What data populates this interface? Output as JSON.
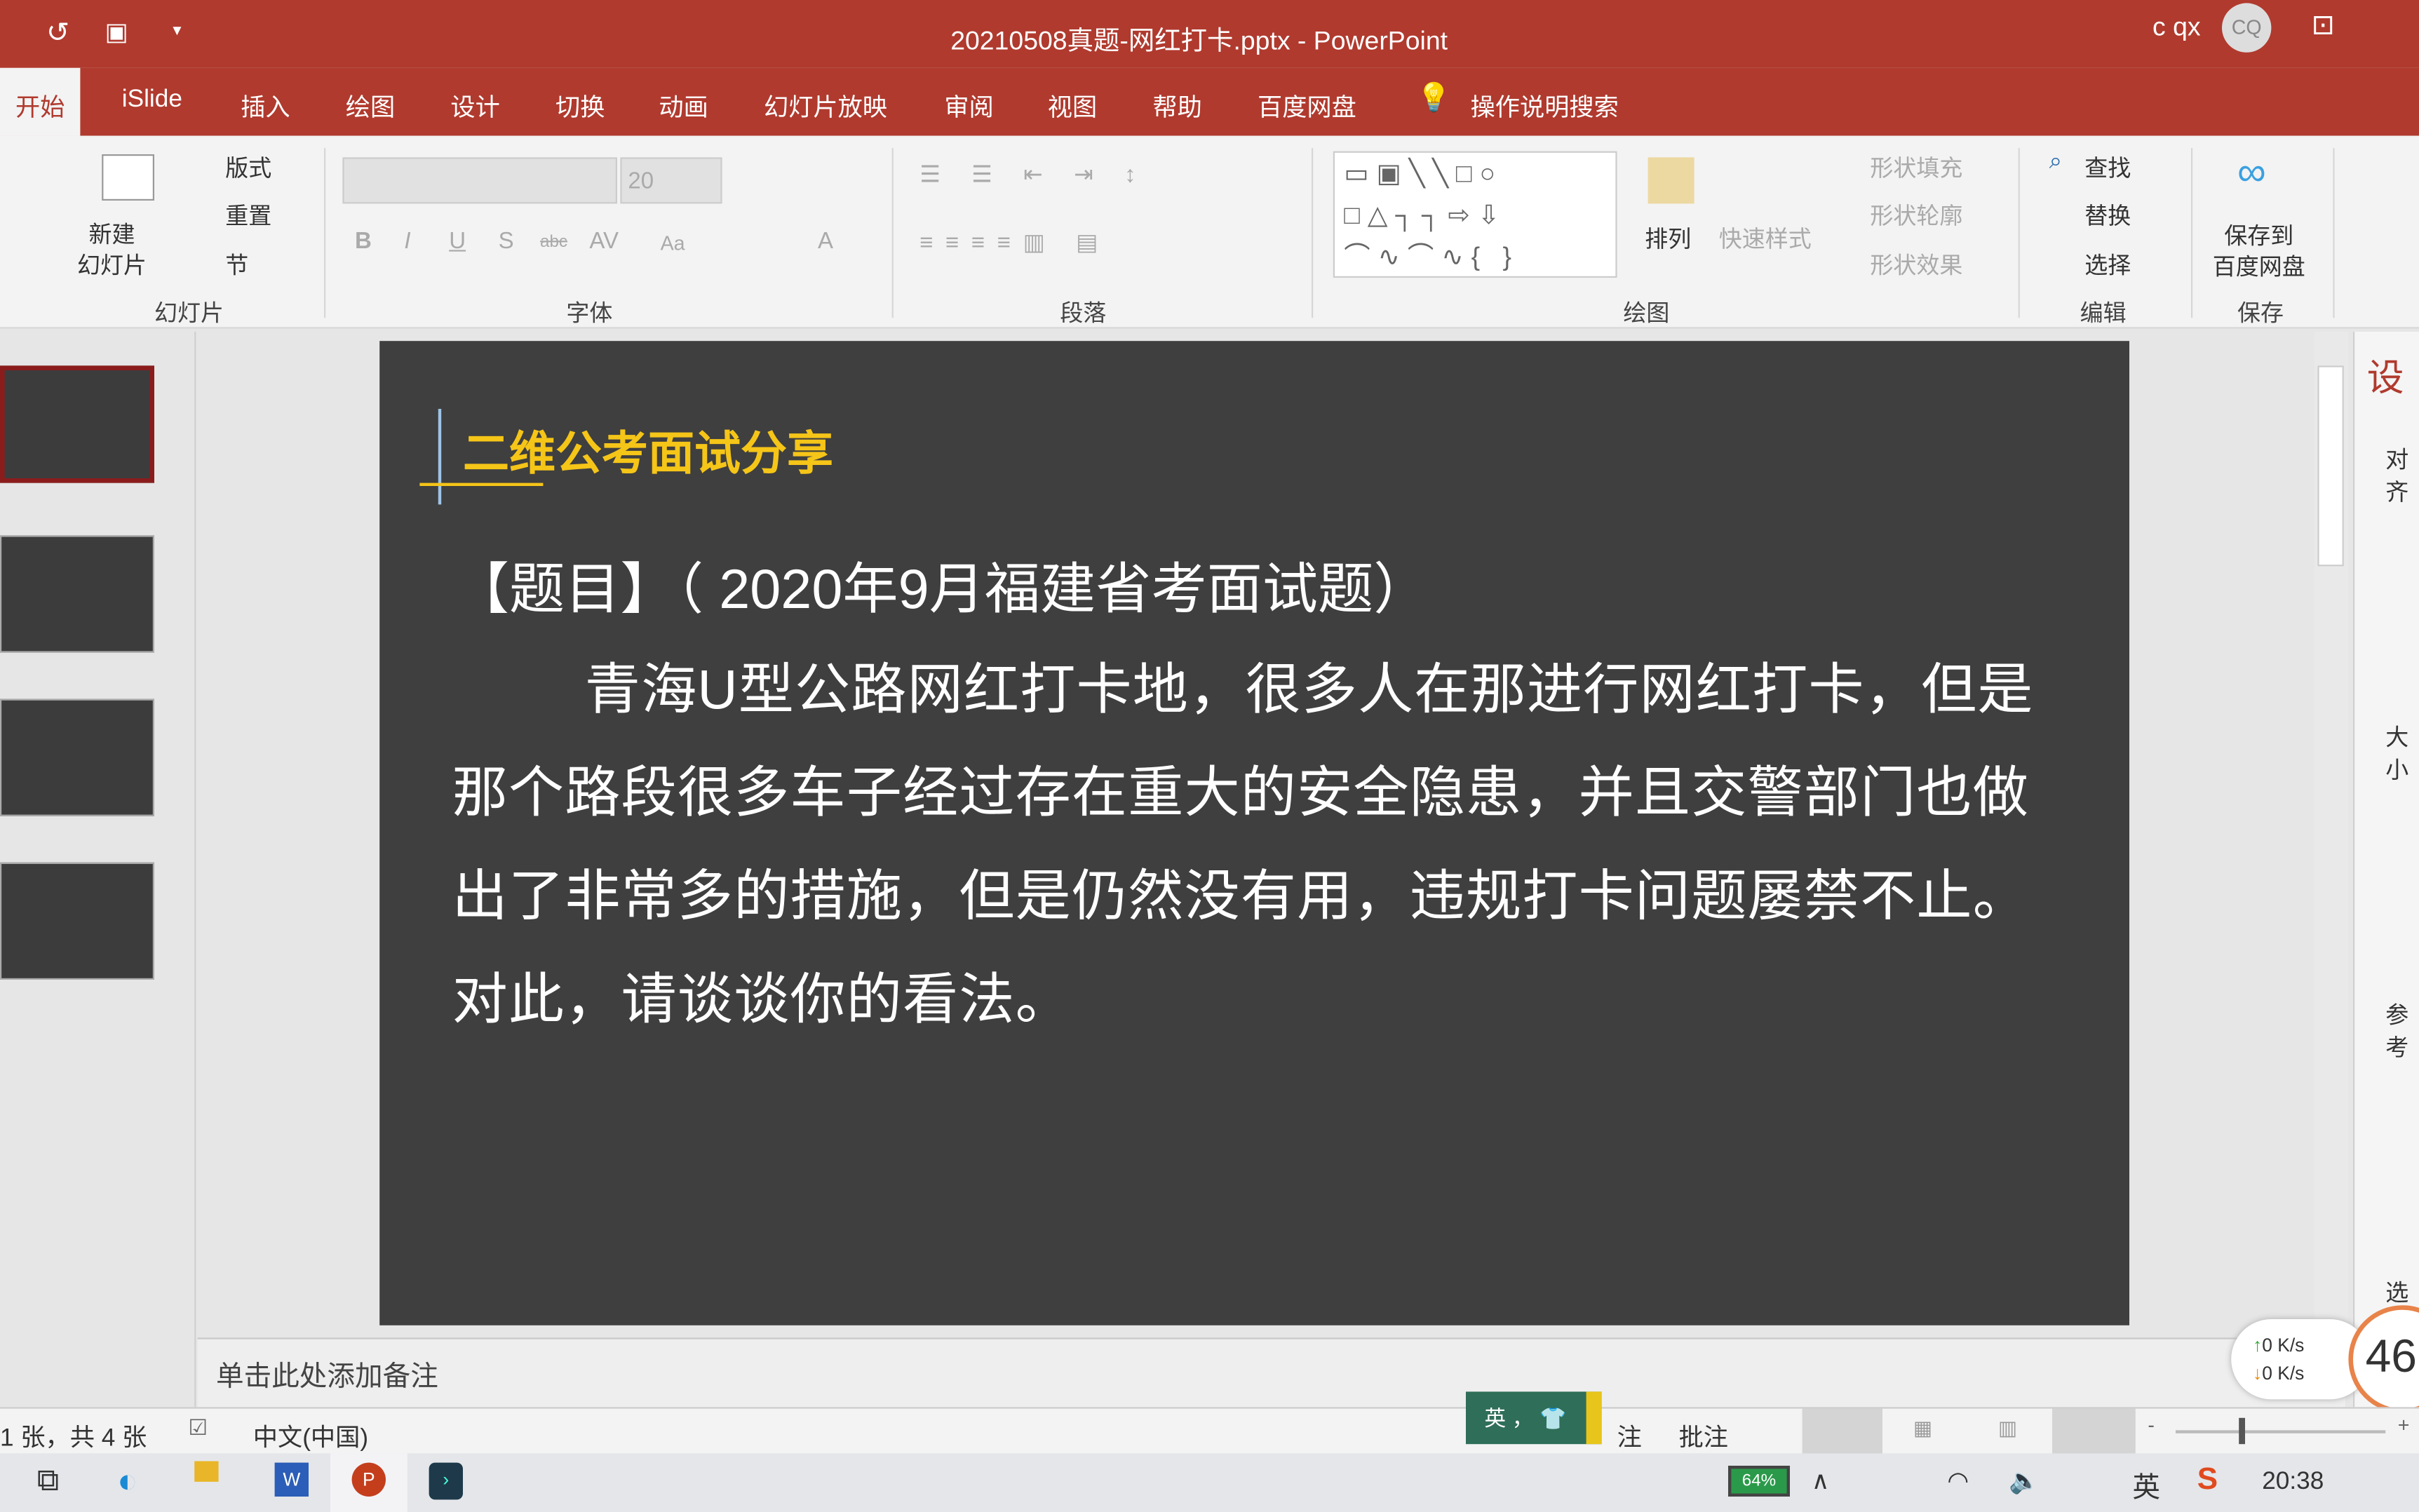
{
  "titlebar": {
    "title": "20210508真题-网红打卡.pptx  -  PowerPoint",
    "user": "c qx",
    "avatar": "CQ"
  },
  "tabs": [
    "开始",
    "iSlide",
    "插入",
    "绘图",
    "设计",
    "切换",
    "动画",
    "幻灯片放映",
    "审阅",
    "视图",
    "帮助",
    "百度网盘"
  ],
  "tell_me": "操作说明搜索",
  "ribbon": {
    "slides": {
      "new_slide": "新建\n幻灯片",
      "layout": "版式",
      "reset": "重置",
      "section": "节",
      "label": "幻灯片"
    },
    "font": {
      "font_size": "20",
      "label": "字体",
      "bold": "B",
      "italic": "I",
      "underline": "U",
      "shadow": "S",
      "strike": "abc",
      "spacing": "AV",
      "case": "Aa",
      "color": "A"
    },
    "paragraph": {
      "label": "段落"
    },
    "drawing": {
      "arrange": "排列",
      "quick_styles": "快速样式",
      "shape_fill": "形状填充",
      "shape_outline": "形状轮廓",
      "shape_effects": "形状效果",
      "label": "绘图"
    },
    "editing": {
      "find": "查找",
      "replace": "替换",
      "select": "选择",
      "label": "编辑"
    },
    "save": {
      "save_baidu": "保存到\n百度网盘",
      "label": "保存"
    }
  },
  "slide": {
    "heading": "二维公考面试分享",
    "question_title": "【题目】（ 2020年9月福建省考面试题）",
    "body": "青海U型公路网红打卡地，很多人在那进行网红打卡，但是那个路段很多车子经过存在重大的安全隐患，并且交警部门也做出了非常多的措施，但是仍然没有用，违规打卡问题屡禁不止。对此，请谈谈你的看法。",
    "accent": "#f5c518"
  },
  "notes_placeholder": "单击此处添加备注",
  "status": {
    "slide_count": "1 张，共 4 张",
    "language": "中文(中国)",
    "notes": "注",
    "comments": "批注",
    "ime": "英"
  },
  "right_pane": {
    "title": "设",
    "items": [
      "对齐",
      "大小",
      "参考",
      "选择"
    ]
  },
  "net": {
    "up": "0  K/s",
    "down": "0  K/s",
    "gauge": "46"
  },
  "taskbar": {
    "battery": "64%",
    "ime": "英",
    "time": "20:38"
  }
}
